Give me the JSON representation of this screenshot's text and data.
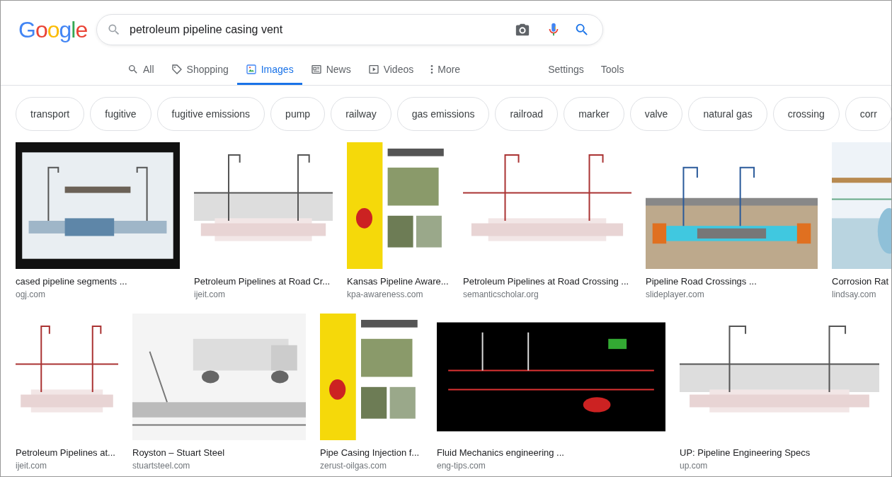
{
  "logo": "Google",
  "search": {
    "value": "petroleum pipeline casing vent"
  },
  "tabs": [
    {
      "label": "All",
      "selected": false
    },
    {
      "label": "Shopping",
      "selected": false
    },
    {
      "label": "Images",
      "selected": true
    },
    {
      "label": "News",
      "selected": false
    },
    {
      "label": "Videos",
      "selected": false
    },
    {
      "label": "More",
      "selected": false
    }
  ],
  "tools": [
    "Settings",
    "Tools"
  ],
  "chips": [
    "transport",
    "fugitive",
    "fugitive emissions",
    "pump",
    "railway",
    "gas emissions",
    "railroad",
    "marker",
    "valve",
    "natural gas",
    "crossing",
    "corr"
  ],
  "rows": [
    [
      {
        "caption": "cased pipeline segments ...",
        "source": "ogj.com"
      },
      {
        "caption": "Petroleum Pipelines at Road Cr...",
        "source": "ijeit.com"
      },
      {
        "caption": "Kansas Pipeline Aware...",
        "source": "kpa-awareness.com"
      },
      {
        "caption": "Petroleum Pipelines at Road Crossing ...",
        "source": "semanticscholar.org"
      },
      {
        "caption": "Pipeline Road Crossings ...",
        "source": "slideplayer.com"
      },
      {
        "caption": "Corrosion Rat",
        "source": "lindsay.com"
      }
    ],
    [
      {
        "caption": "Petroleum Pipelines at...",
        "source": "ijeit.com"
      },
      {
        "caption": "Royston – Stuart Steel",
        "source": "stuartsteel.com"
      },
      {
        "caption": "Pipe Casing Injection f...",
        "source": "zerust-oilgas.com"
      },
      {
        "caption": "Fluid Mechanics engineering ...",
        "source": "eng-tips.com"
      },
      {
        "caption": "UP: Pipeline Engineering Specs",
        "source": "up.com"
      }
    ]
  ]
}
